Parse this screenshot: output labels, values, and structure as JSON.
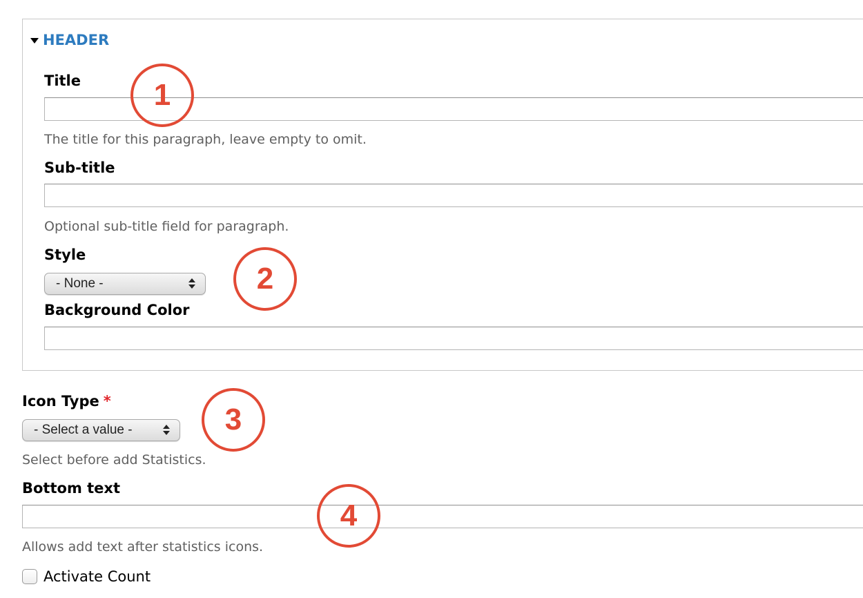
{
  "header_section": {
    "legend": "HEADER",
    "title_field": {
      "label": "Title",
      "value": "",
      "help": "The title for this paragraph, leave empty to omit."
    },
    "subtitle_field": {
      "label": "Sub-title",
      "value": "",
      "help": "Optional sub-title field for paragraph."
    },
    "style_field": {
      "label": "Style",
      "selected": "- None -"
    },
    "background_color_field": {
      "label": "Background Color",
      "value": ""
    }
  },
  "icon_type_field": {
    "label": "Icon Type",
    "required_marker": "*",
    "selected": "- Select a value -",
    "help": "Select before add Statistics."
  },
  "bottom_text_field": {
    "label": "Bottom text",
    "value": "",
    "help": "Allows add text after statistics icons."
  },
  "activate_count": {
    "label": "Activate Count",
    "checked": false
  },
  "annotations": [
    "1",
    "2",
    "3",
    "4"
  ],
  "colors": {
    "legend_link": "#2d7bbf",
    "annotation_red": "#e24a35",
    "required_red": "#e0262b",
    "help_text": "#606060"
  }
}
